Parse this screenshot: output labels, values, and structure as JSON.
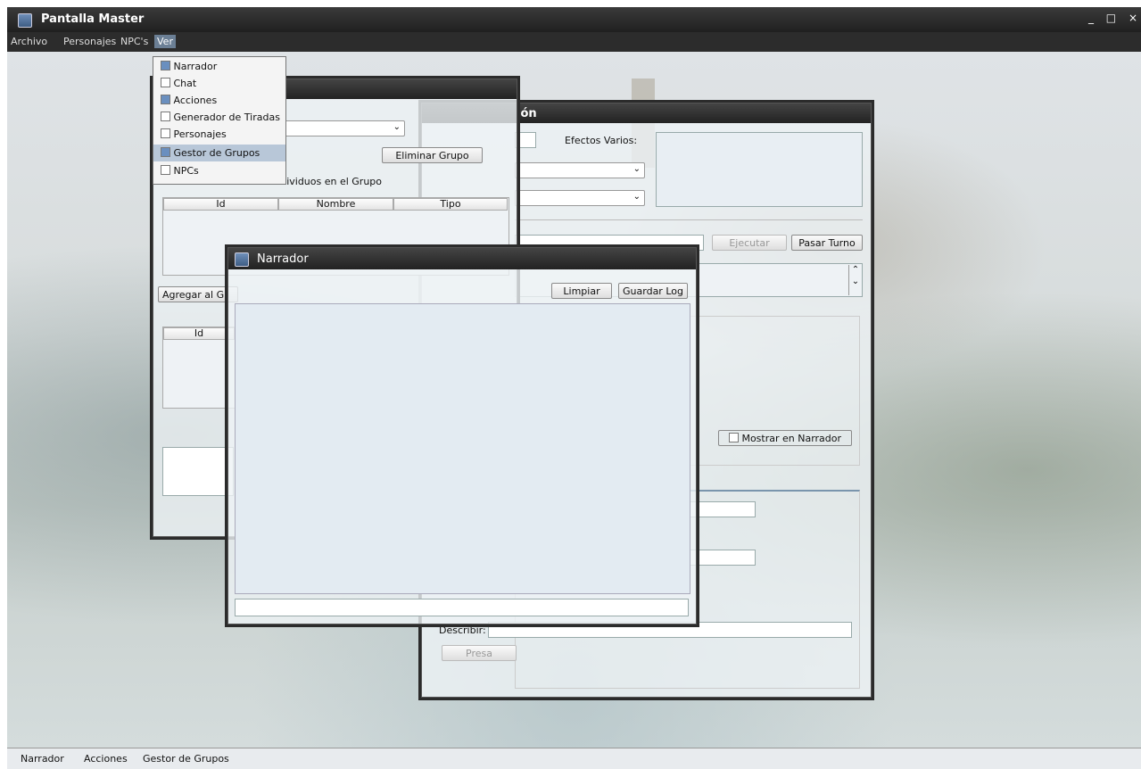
{
  "window": {
    "title": "Pantalla Master",
    "controls": [
      "_",
      "□",
      "×"
    ]
  },
  "menubar": [
    {
      "label": "Archivo"
    },
    {
      "label": "Personajes"
    },
    {
      "label": "NPC's"
    },
    {
      "label": "Ver"
    }
  ],
  "ver_menu": {
    "items": [
      {
        "label": "Narrador",
        "checked": true
      },
      {
        "label": "Chat",
        "checked": false
      },
      {
        "label": "Acciones",
        "checked": true
      },
      {
        "label": "Generador de Tiradas",
        "checked": false
      },
      {
        "label": "Personajes",
        "checked": false
      },
      {
        "label": "Gestor de Grupos",
        "checked": true,
        "highlighted": true
      },
      {
        "label": "NPCs",
        "checked": false
      }
    ]
  },
  "grupos_panel": {
    "eliminar_label": "Eliminar Grupo",
    "individuos_label": "Individuos en el Grupo",
    "columns": [
      "Id",
      "Nombre",
      "Tipo"
    ],
    "agregar_label": "Agregar al Gr",
    "lower_col": "Id"
  },
  "acciones_panel": {
    "title_fragment": "ión",
    "efectos_label": "Efectos Varios:",
    "ejecutar_label": "Ejecutar",
    "pasar_turno_label": "Pasar Turno",
    "mostrar_label": "Mostrar en Narrador",
    "describir_label": "Describir:",
    "presa_label": "Presa"
  },
  "narrador_panel": {
    "title": "Narrador",
    "limpiar_label": "Limpiar",
    "guardar_label": "Guardar Log"
  },
  "taskbar": [
    {
      "label": "Narrador"
    },
    {
      "label": "Acciones"
    },
    {
      "label": "Gestor de Grupos"
    }
  ],
  "icons": [
    "java-app-icon",
    "check-icon",
    "chevron-down-icon",
    "chevron-up-icon"
  ]
}
